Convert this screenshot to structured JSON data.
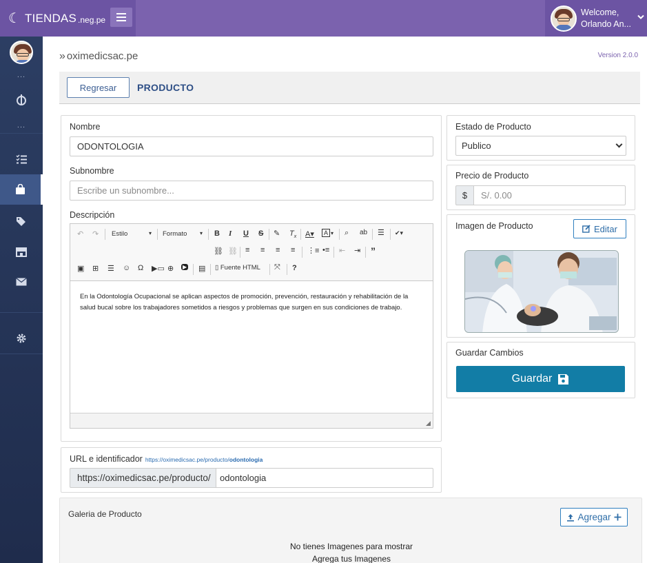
{
  "brand": {
    "name": "TIENDAS",
    "tld": ".neg.pe"
  },
  "user": {
    "greeting": "Welcome,",
    "name": "Orlando An..."
  },
  "sidebar": {
    "dots": "...",
    "items": [
      "jedi-icon",
      "tasks-icon",
      "shopping-bag-icon",
      "tags-icon",
      "store-icon",
      "envelope-icon",
      "gear-icon"
    ]
  },
  "breadcrumb": {
    "arrow": "»",
    "text": "oximedicsac.pe"
  },
  "version": "Version 2.0.0",
  "header": {
    "back_label": "Regresar",
    "title": "PRODUCTO"
  },
  "form": {
    "nombre_label": "Nombre",
    "nombre_value": "ODONTOLOGIA",
    "subnombre_label": "Subnombre",
    "subnombre_placeholder": "Escribe un subnombre...",
    "descripcion_label": "Descripción",
    "descripcion_text": "En la Odontología Ocupacional se aplican aspectos de promoción, prevención, restauración y rehabilitación de la salud bucal sobre los trabajadores sometidos a riesgos y problemas que surgen en sus condiciones de trabajo."
  },
  "editor_toolbar": {
    "estilo": "Estilo",
    "formato": "Formato",
    "fuente_html": "Fuente HTML"
  },
  "url": {
    "label": "URL e identificador",
    "link_prefix": "https://oximedicsac.pe/producto/",
    "link_slug": "odontologia",
    "base": "https://oximedicsac.pe/producto/",
    "slug": "odontologia"
  },
  "estado": {
    "label": "Estado de Producto",
    "value": "Publico"
  },
  "precio": {
    "label": "Precio de Producto",
    "addon": "$",
    "placeholder": "S/. 0.00"
  },
  "imagen": {
    "label": "Imagen de Producto",
    "edit_label": "Editar"
  },
  "guardar": {
    "label": "Guardar Cambios",
    "button": "Guardar"
  },
  "galeria": {
    "label": "Galeria de Producto",
    "add_label": "Agregar",
    "empty_1": "No tienes Imagenes para mostrar",
    "empty_2": "Agrega tus Imagenes"
  },
  "colors": {
    "topbar": "#7b62ae",
    "sidebar": "#2c3e63",
    "primary": "#127da6",
    "link": "#2f6ea8"
  }
}
